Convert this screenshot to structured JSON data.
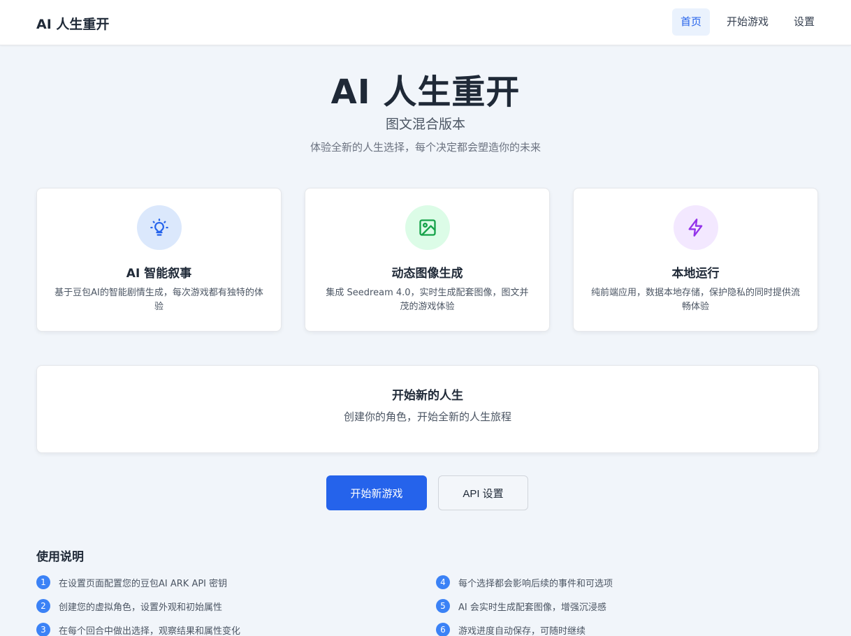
{
  "nav": {
    "brand": "AI 人生重开",
    "links": [
      "首页",
      "开始游戏",
      "设置"
    ]
  },
  "hero": {
    "title": "AI 人生重开",
    "subtitle": "图文混合版本",
    "description": "体验全新的人生选择，每个决定都会塑造你的未来"
  },
  "features": [
    {
      "icon": "lightbulb-icon",
      "icon_bg": "#dbe8fc",
      "icon_color": "#2563eb",
      "title": "AI 智能叙事",
      "desc": "基于豆包AI的智能剧情生成，每次游戏都有独特的体验"
    },
    {
      "icon": "image-icon",
      "icon_bg": "#dcfce7",
      "icon_color": "#16a34a",
      "title": "动态图像生成",
      "desc": "集成 Seedream 4.0，实时生成配套图像，图文并茂的游戏体验"
    },
    {
      "icon": "lightning-icon",
      "icon_bg": "#f3e8ff",
      "icon_color": "#9333ea",
      "title": "本地运行",
      "desc": "纯前端应用，数据本地存储，保护隐私的同时提供流畅体验"
    }
  ],
  "start": {
    "title": "开始新的人生",
    "desc": "创建你的角色，开始全新的人生旅程"
  },
  "buttons": {
    "primary": "开始新游戏",
    "secondary": "API 设置"
  },
  "usage": {
    "title": "使用说明",
    "items": [
      {
        "num": "1",
        "text": "在设置页面配置您的豆包AI ARK API 密钥"
      },
      {
        "num": "2",
        "text": "创建您的虚拟角色，设置外观和初始属性"
      },
      {
        "num": "3",
        "text": "在每个回合中做出选择，观察结果和属性变化"
      },
      {
        "num": "4",
        "text": "每个选择都会影响后续的事件和可选项"
      },
      {
        "num": "5",
        "text": "AI 会实时生成配套图像，增强沉浸感"
      },
      {
        "num": "6",
        "text": "游戏进度自动保存，可随时继续"
      }
    ]
  },
  "colors": {
    "accent": "#2563eb",
    "badge": "#3b82f6"
  }
}
